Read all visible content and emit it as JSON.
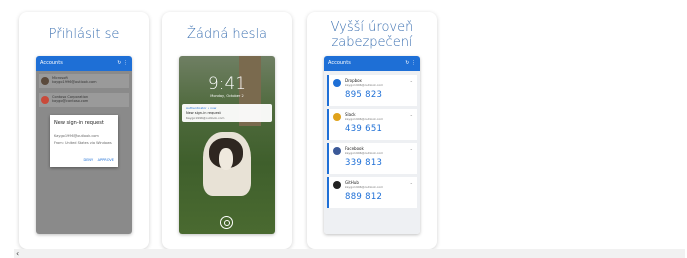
{
  "cards": [
    {
      "title": "Přihlásit se",
      "app_title": "Accounts",
      "rows": [
        {
          "name": "Microsoft",
          "email": "kaygo1996@outlook.com"
        },
        {
          "name": "Contoso Corporation",
          "email": "kaygo@contoso.com"
        }
      ],
      "dialog": {
        "title": "New sign-in request",
        "line1": "Kaygo1996@outlook.com",
        "line2": "From: United States via Windows",
        "deny": "DENY",
        "approve": "APPROVE"
      }
    },
    {
      "title": "Žádná hesla",
      "clock": "9:41",
      "date": "Monday, October 2",
      "notif": {
        "app": "Authenticator • now",
        "title": "New sign-in request",
        "sub": "Kaygo1996@outlook.com"
      }
    },
    {
      "title_line1": "Vyšší úroveň",
      "title_line2": "zabezpečení",
      "app_title": "Accounts",
      "accounts": [
        {
          "name": "Dropbox",
          "email": "kaygo1996@outlook.com",
          "code": "895 823",
          "color": "#1e6fd6"
        },
        {
          "name": "Slack",
          "email": "kaygo1996@outlook.com",
          "code": "439 651",
          "color": "#e0a21a"
        },
        {
          "name": "Facebook",
          "email": "kaygo1996@outlook.com",
          "code": "339 813",
          "color": "#3b5998"
        },
        {
          "name": "GitHub",
          "email": "kaygo1996@outlook.com",
          "code": "889 812",
          "color": "#222222"
        }
      ]
    }
  ],
  "appbar_icons": "↻ ⋮",
  "refresh_glyph": "↻",
  "back_glyph": "‹"
}
